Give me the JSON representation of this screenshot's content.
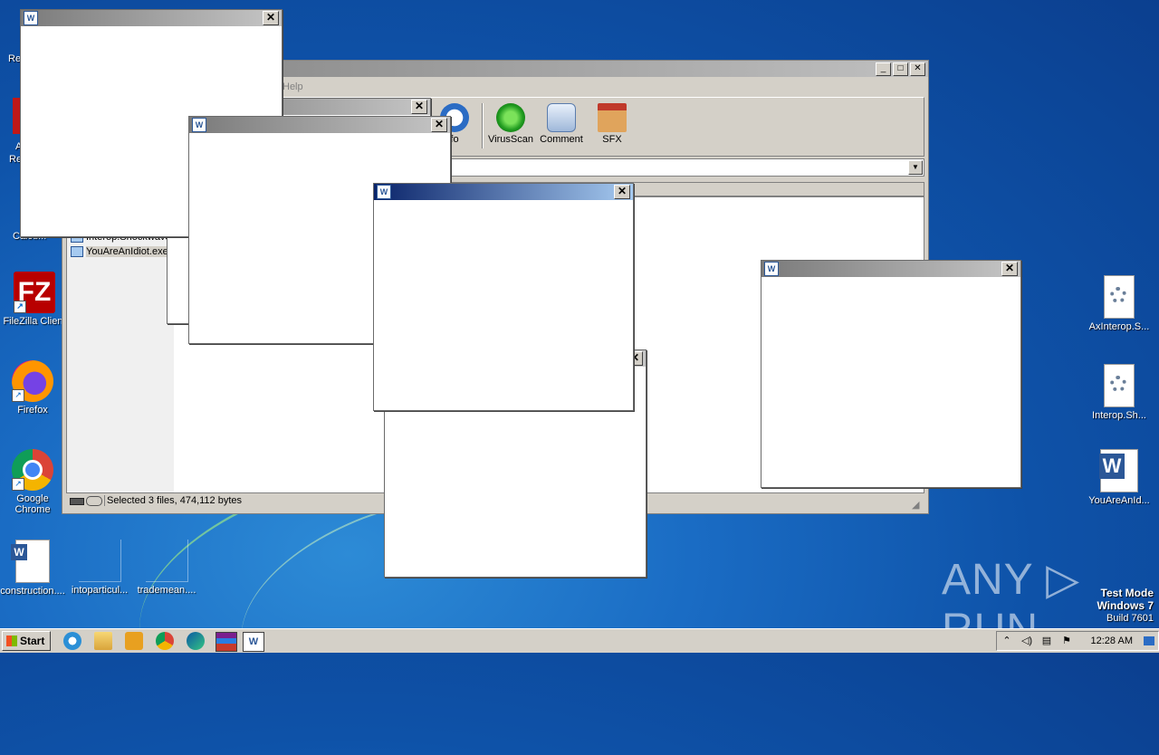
{
  "desktop": {
    "left_icons": [
      {
        "label": "FileZilla Client",
        "icon": "filezilla-icon"
      },
      {
        "label": "Firefox",
        "icon": "firefox-icon"
      },
      {
        "label": "Google Chrome",
        "icon": "chrome-icon"
      },
      {
        "label": "construction....",
        "icon": "word-doc-icon"
      },
      {
        "label": "intoparticul...",
        "icon": "file-icon"
      },
      {
        "label": "trademean....",
        "icon": "file-icon"
      }
    ],
    "partial_labels": [
      "Re",
      "A",
      "Re",
      "Calcu..."
    ],
    "right_icons": [
      {
        "label": "AxInterop.S...",
        "icon": "dll-gear-icon"
      },
      {
        "label": "Interop.Sh...",
        "icon": "dll-gear-icon"
      },
      {
        "label": "YouAreAnId...",
        "icon": "word-icon"
      }
    ]
  },
  "winrar": {
    "menu_help": "Help",
    "toolbar": [
      {
        "label": "fo",
        "icon": "info-icon"
      },
      {
        "label": "VirusScan",
        "icon": "virusscan-icon"
      },
      {
        "label": "Comment",
        "icon": "comment-icon"
      },
      {
        "label": "SFX",
        "icon": "sfx-icon"
      }
    ],
    "files": [
      "Interop.ShockwaveF...",
      "YouAreAnIdiot.exe"
    ],
    "status": "Selected 3 files, 474,112 bytes",
    "icon_letter": "W"
  },
  "popups": {
    "close_glyph": "✕"
  },
  "taskbar": {
    "start": "Start",
    "clock": "12:28 AM"
  },
  "watermark": "ANY ▷ RUN",
  "test_mode": {
    "line1": "Test Mode",
    "line2": "Windows 7",
    "line3": "Build 7601"
  }
}
